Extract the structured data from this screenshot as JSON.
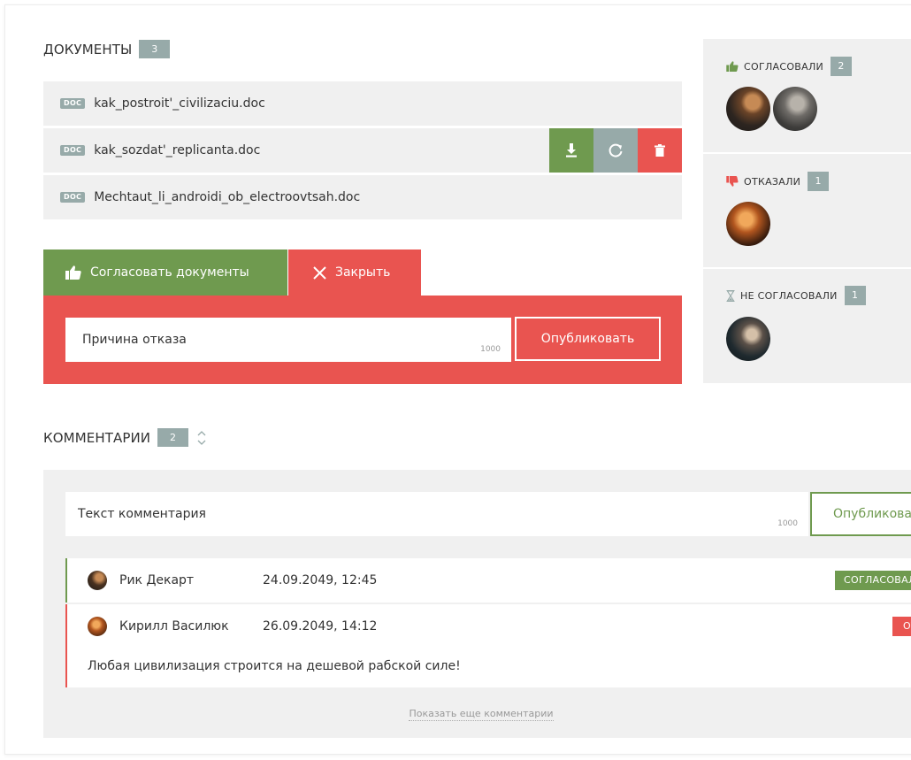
{
  "documents": {
    "title": "ДОКУМЕНТЫ",
    "count": "3",
    "files": [
      {
        "icon_label": "DOC",
        "name": "kak_postroit'_civilizaciu.doc"
      },
      {
        "icon_label": "DOC",
        "name": "kak_sozdat'_replicanta.doc"
      },
      {
        "icon_label": "DOC",
        "name": "Mechtaut_li_androidi_ob_electroovtsah.doc"
      }
    ],
    "row_actions": [
      "download-icon",
      "refresh-icon",
      "trash-icon"
    ]
  },
  "tabs": {
    "approve_label": "Согласовать документы",
    "close_label": "Закрыть"
  },
  "reject_form": {
    "placeholder": "Причина отказа",
    "limit": "1000",
    "publish_label": "Опубликовать"
  },
  "approvals": {
    "approved": {
      "label": "СОГЛАСОВАЛИ",
      "count": "2"
    },
    "rejected": {
      "label": "ОТКАЗАЛИ",
      "count": "1"
    },
    "pending": {
      "label": "НЕ СОГЛАСОВАЛИ",
      "count": "1"
    }
  },
  "comments": {
    "title": "КОММЕНТАРИИ",
    "count": "2",
    "input_placeholder": "Текст комментария",
    "limit": "1000",
    "publish_label": "Опубликовать",
    "items": [
      {
        "author": "Рик Декарт",
        "date": "24.09.2049, 12:45",
        "status": "СОГЛАСОВАЛ",
        "text": ""
      },
      {
        "author": "Кирилл Василюк",
        "date": "26.09.2049, 14:12",
        "status": "ОТКАЗАЛ",
        "text": "Любая цивилизация строится на дешевой рабской силе!"
      }
    ],
    "show_more": "Показать еще комментарии"
  },
  "colors": {
    "green": "#6f9a4f",
    "red": "#e95450",
    "grey_badge": "#97aaa9",
    "panel_bg": "#f0f0f0"
  }
}
